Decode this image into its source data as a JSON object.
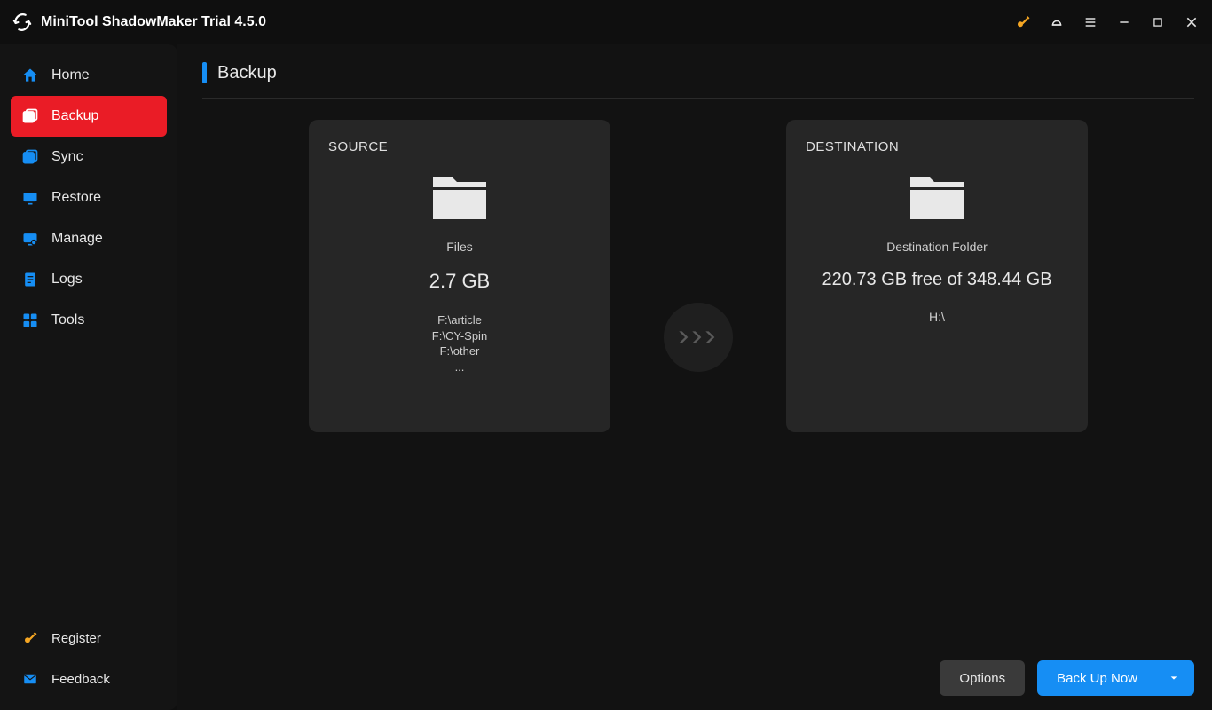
{
  "app": {
    "title": "MiniTool ShadowMaker Trial 4.5.0"
  },
  "sidebar": {
    "items": [
      {
        "label": "Home"
      },
      {
        "label": "Backup"
      },
      {
        "label": "Sync"
      },
      {
        "label": "Restore"
      },
      {
        "label": "Manage"
      },
      {
        "label": "Logs"
      },
      {
        "label": "Tools"
      }
    ],
    "bottom": [
      {
        "label": "Register"
      },
      {
        "label": "Feedback"
      }
    ]
  },
  "page": {
    "title": "Backup"
  },
  "source": {
    "header": "SOURCE",
    "subtitle": "Files",
    "size": "2.7 GB",
    "paths": [
      "F:\\article",
      "F:\\CY-Spin",
      "F:\\other",
      "..."
    ]
  },
  "destination": {
    "header": "DESTINATION",
    "subtitle": "Destination Folder",
    "free_line": "220.73 GB free of 348.44 GB",
    "drive": "H:\\"
  },
  "footer": {
    "options_label": "Options",
    "primary_label": "Back Up Now"
  }
}
